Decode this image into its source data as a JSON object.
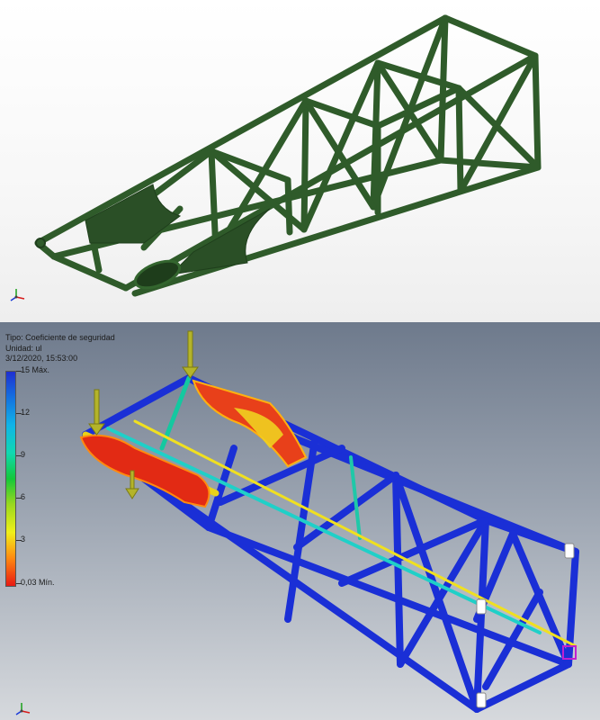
{
  "top_view": {
    "triad_icon": "xyz-axis-triad-icon"
  },
  "bottom_view": {
    "info": {
      "type_line": "Tipo: Coeficiente de seguridad",
      "unit_line": "Unidad: ul",
      "date_line": "3/12/2020, 15:53:00"
    },
    "legend": {
      "max_label": "15 Máx.",
      "tick_12": "12",
      "tick_9": "9",
      "tick_6": "6",
      "tick_3": "3",
      "min_label": "0,03 Mín.",
      "colors": [
        "#1f2fd0",
        "#10b4e8",
        "#14c83a",
        "#f0f01a",
        "#e81a14"
      ]
    },
    "load_arrow_color": "#b4b42a",
    "triad_icon": "xyz-axis-triad-icon"
  },
  "colors": {
    "truss_green": "#2f5b2a",
    "truss_green_dark": "#1f3f1c",
    "fea_blue": "#1a2fd6"
  }
}
